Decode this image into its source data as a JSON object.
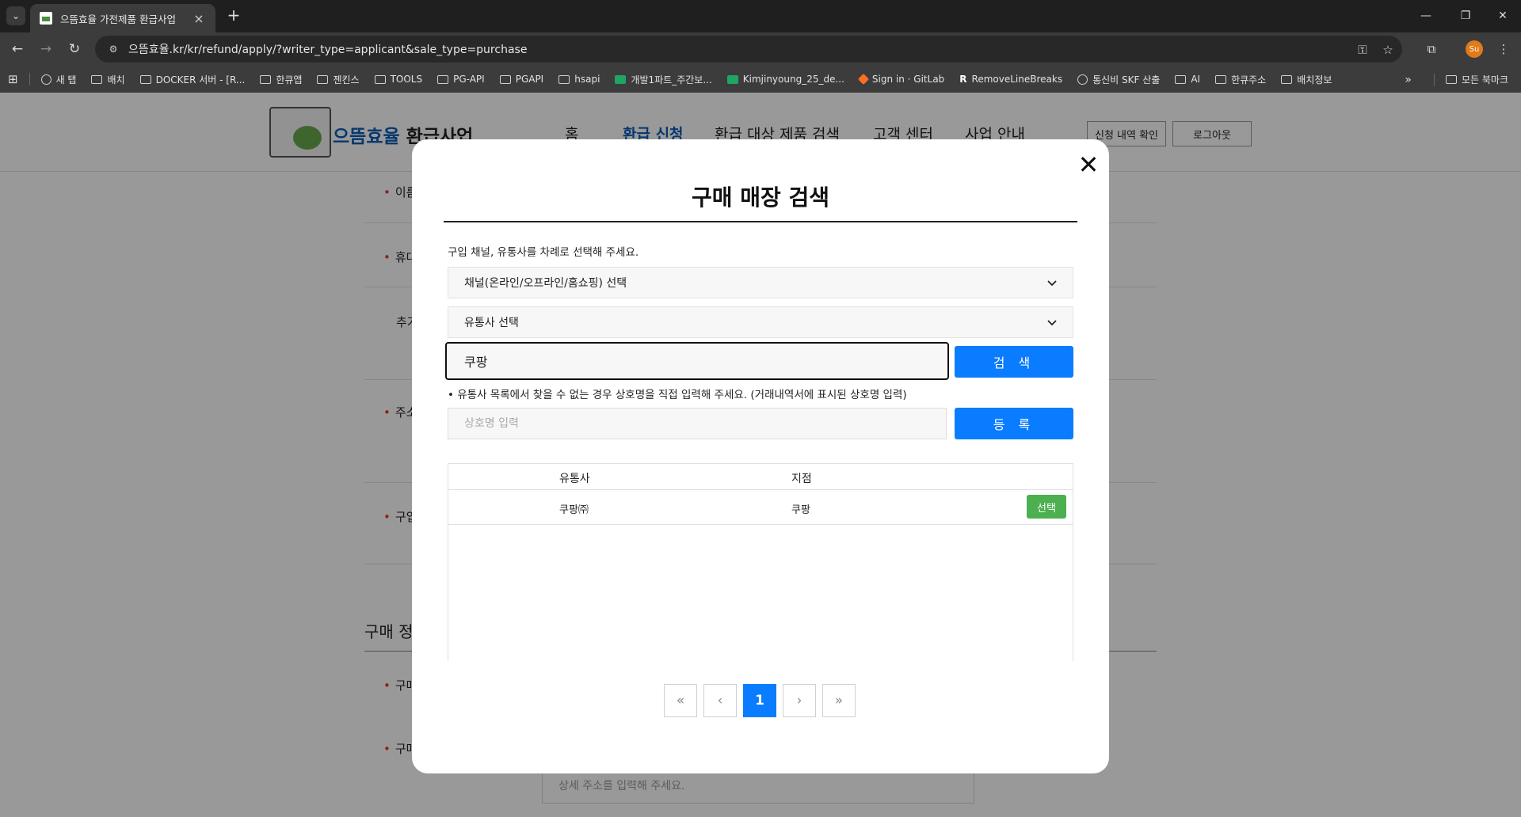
{
  "browser": {
    "tab_title": "으뜸효율 가전제품 환급사업",
    "url": "으뜸효율.kr/kr/refund/apply/?writer_type=applicant&sale_type=purchase",
    "profile_initials": "Su",
    "bookmarks": [
      {
        "label": "새 탭",
        "icon": "globe-icon"
      },
      {
        "label": "배치",
        "icon": "folder-icon"
      },
      {
        "label": "DOCKER 서버 - [R...",
        "icon": "folder-icon"
      },
      {
        "label": "한큐앱",
        "icon": "folder-icon"
      },
      {
        "label": "젠킨스",
        "icon": "folder-icon"
      },
      {
        "label": "TOOLS",
        "icon": "folder-icon"
      },
      {
        "label": "PG-API",
        "icon": "folder-icon"
      },
      {
        "label": "PGAPI",
        "icon": "folder-icon"
      },
      {
        "label": "hsapi",
        "icon": "folder-icon"
      },
      {
        "label": "개발1파트_주간보...",
        "icon": "sheet-icon"
      },
      {
        "label": "Kimjinyoung_25_de...",
        "icon": "sheet-icon"
      },
      {
        "label": "Sign in · GitLab",
        "icon": "gitlab-icon"
      },
      {
        "label": "RemoveLineBreaks",
        "icon": "r-icon"
      },
      {
        "label": "통신비 SKF 산출",
        "icon": "globe-icon"
      },
      {
        "label": "AI",
        "icon": "folder-icon"
      },
      {
        "label": "한큐주소",
        "icon": "folder-icon"
      },
      {
        "label": "배치정보",
        "icon": "folder-icon"
      }
    ],
    "all_bookmarks": "모든 북마크"
  },
  "site": {
    "logo_part1": "으뜸효율",
    "logo_part2": "환급사업",
    "nav": [
      "홈",
      "환급 신청",
      "환급 대상 제품 검색",
      "고객 센터",
      "사업 안내"
    ],
    "check_button": "신청 내역 확인",
    "logout_button": "로그아웃",
    "labels": [
      "이름",
      "휴대",
      "추가",
      "주소",
      "구입",
      "구매",
      "구매"
    ],
    "section_title": "구매 정",
    "address_detail_placeholder": "상세 주소를 입력해 주세요."
  },
  "modal": {
    "title": "구매 매장 검색",
    "instruction": "구입 채널, 유통사를 차례로 선택해 주세요.",
    "channel_select": "채널(온라인/오프라인/홈쇼핑) 선택",
    "distributor_select": "유통사 선택",
    "search_value": "쿠팡",
    "search_button": "검 색",
    "note": "• 유통사 목록에서 찾을 수 없는 경우 상호명을 직접 입력해 주세요. (거래내역서에 표시된 상호명 입력)",
    "name_placeholder": "상호명 입력",
    "register_button": "등 록",
    "table": {
      "headers": [
        "유통사",
        "지점"
      ],
      "rows": [
        {
          "distributor": "쿠팡㈜",
          "branch": "쿠팡",
          "action": "선택"
        }
      ]
    },
    "pagination": {
      "first": "«",
      "prev": "‹",
      "current": "1",
      "next": "›",
      "last": "»"
    }
  }
}
